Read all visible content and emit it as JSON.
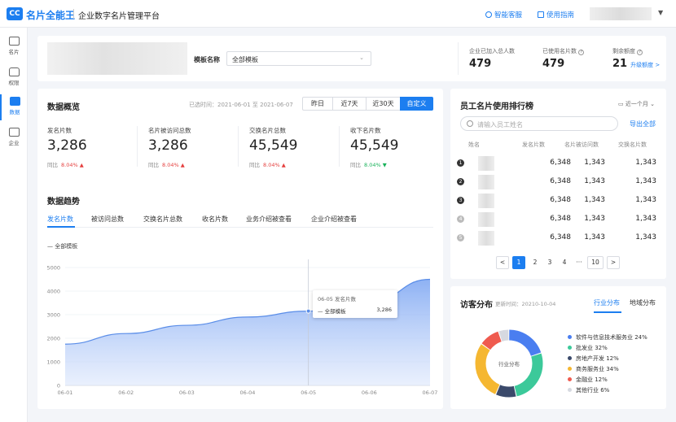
{
  "header": {
    "logo_text": "CC",
    "brand": "名片全能王",
    "platform": "企业数字名片管理平台",
    "support_label": "智能客服",
    "guide_label": "使用指南"
  },
  "sidebar": {
    "items": [
      {
        "label": "名片",
        "icon": "card-icon"
      },
      {
        "label": "权限",
        "icon": "lock-icon"
      },
      {
        "label": "数据",
        "icon": "chart-icon",
        "active": true
      },
      {
        "label": "企业",
        "icon": "building-icon"
      }
    ]
  },
  "filter": {
    "template_label": "模板名称",
    "template_value": "全部模板",
    "stats": [
      {
        "label": "企业已加入总人数",
        "value": "479"
      },
      {
        "label": "已使用名片数",
        "value": "479"
      },
      {
        "label": "剩余额度",
        "value": "21",
        "link": "升级额度 >"
      }
    ]
  },
  "overview": {
    "title": "数据概览",
    "selected_range": "已选时间：2021-06-01 至 2021-06-07",
    "range_buttons": [
      "昨日",
      "近7天",
      "近30天",
      "自定义"
    ],
    "active_range": 3,
    "kpis": [
      {
        "label": "发名片数",
        "value": "3,286",
        "cmp_label": "同比",
        "cmp": "8.04%",
        "dir": "up"
      },
      {
        "label": "名片被访问总数",
        "value": "3,286",
        "cmp_label": "同比",
        "cmp": "8.04%",
        "dir": "up"
      },
      {
        "label": "交换名片总数",
        "value": "45,549",
        "cmp_label": "同比",
        "cmp": "8.04%",
        "dir": "up"
      },
      {
        "label": "收下名片数",
        "value": "45,549",
        "cmp_label": "同比",
        "cmp": "8.04%",
        "dir": "down"
      }
    ]
  },
  "trend": {
    "title": "数据趋势",
    "tabs": [
      "发名片数",
      "被访问总数",
      "交换名片总数",
      "收名片数",
      "业务介绍被查看",
      "企业介绍被查看"
    ],
    "active_tab": 0,
    "series_legend": "全部模板",
    "tooltip": {
      "title": "06-05 发名片数",
      "series": "全部模板",
      "value": "3,286"
    }
  },
  "chart_data": {
    "type": "area",
    "x": [
      "06-01",
      "06-02",
      "06-03",
      "06-04",
      "06-05",
      "06-06",
      "06-07"
    ],
    "series": [
      {
        "name": "全部模板",
        "values": [
          1750,
          2200,
          2550,
          2900,
          3150,
          3500,
          4500
        ]
      }
    ],
    "ylim": [
      0,
      5000
    ],
    "yticks": [
      0,
      1000,
      2000,
      3000,
      4000,
      5000
    ],
    "color": "#6b9cf0"
  },
  "ranking": {
    "title": "员工名片使用排行榜",
    "period": "近一个月",
    "search_placeholder": "请输入员工姓名",
    "export_label": "导出全部",
    "columns": [
      "姓名",
      "发名片数",
      "名片被访问数",
      "交换名片数"
    ],
    "rows": [
      {
        "rank": "1",
        "sent": "6,348",
        "visited": "1,343",
        "exchanged": "1,343"
      },
      {
        "rank": "2",
        "sent": "6,348",
        "visited": "1,343",
        "exchanged": "1,343"
      },
      {
        "rank": "3",
        "sent": "6,348",
        "visited": "1,343",
        "exchanged": "1,343"
      },
      {
        "rank": "4",
        "sent": "6,348",
        "visited": "1,343",
        "exchanged": "1,343"
      },
      {
        "rank": "5",
        "sent": "6,348",
        "visited": "1,343",
        "exchanged": "1,343"
      }
    ],
    "pagination": {
      "pages": [
        "1",
        "2",
        "3",
        "4",
        "···",
        "10"
      ],
      "current": "1"
    }
  },
  "visitors": {
    "title": "访客分布",
    "updated": "更新时间：20210-10-04",
    "tabs": [
      "行业分布",
      "地域分布"
    ],
    "active_tab": 0,
    "donut_center": "行业分布",
    "legend": [
      {
        "label": "软件与信息技术服务业 24%",
        "color": "#4a7ef0"
      },
      {
        "label": "批发业 32%",
        "color": "#3cc99a"
      },
      {
        "label": "房地产开发 12%",
        "color": "#3b4a6b"
      },
      {
        "label": "商务服务业 34%",
        "color": "#f5b731"
      },
      {
        "label": "金融业 12%",
        "color": "#ef5b4f"
      },
      {
        "label": "其他行业 6%",
        "color": "#d6d9e0"
      }
    ]
  }
}
